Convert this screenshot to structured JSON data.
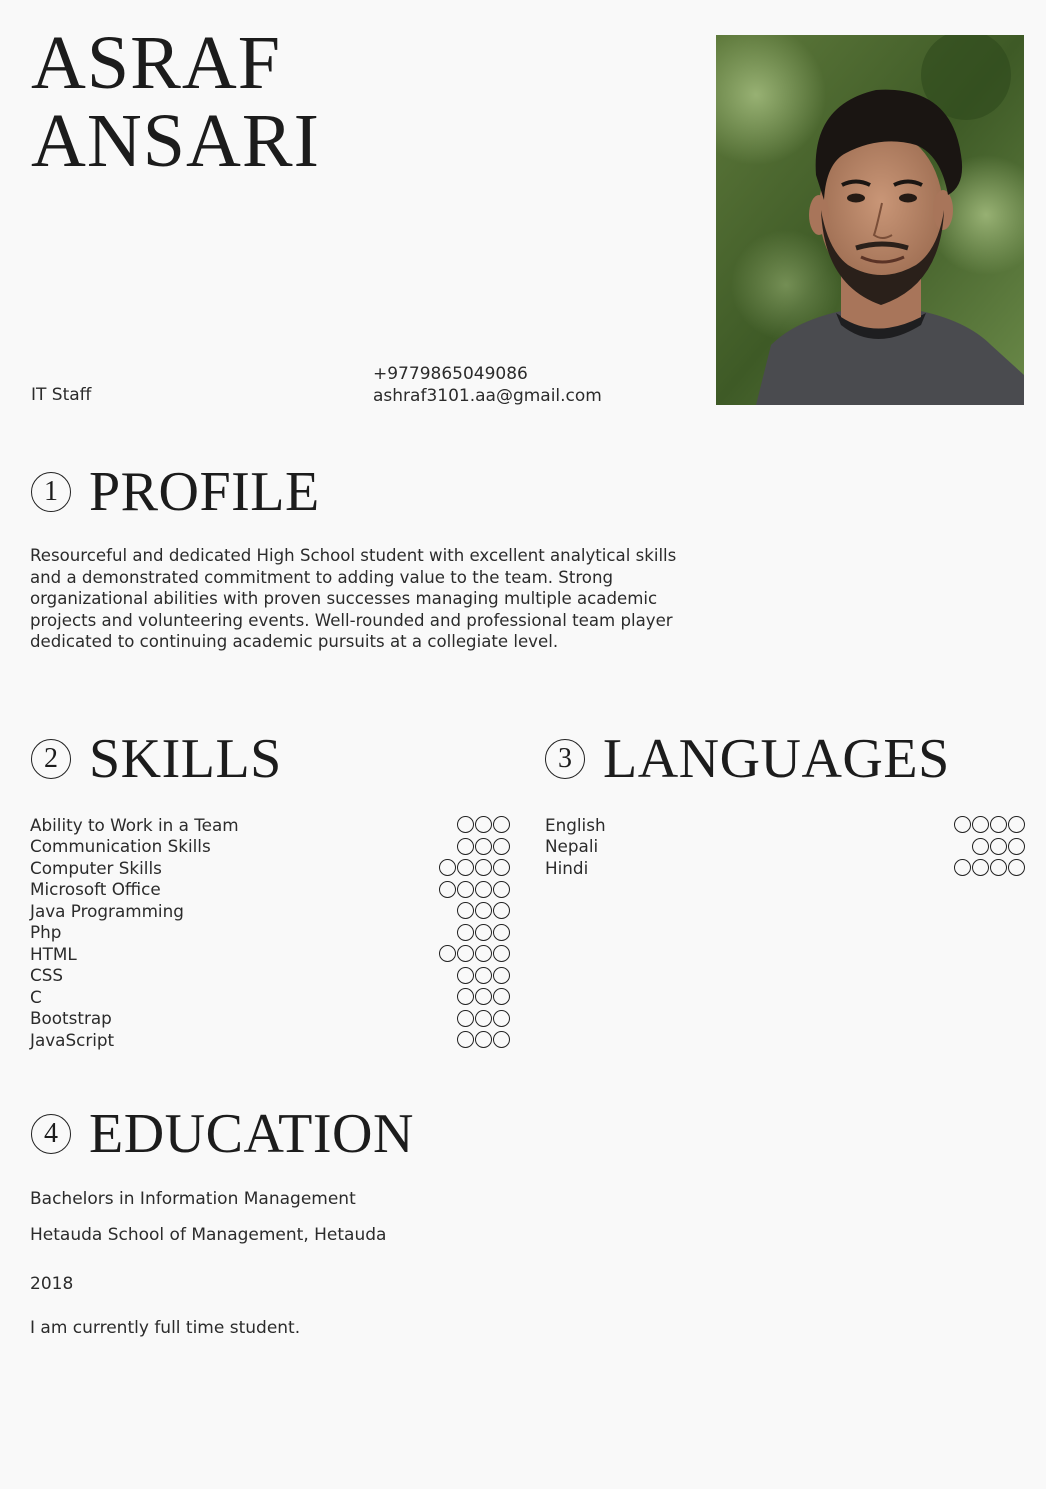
{
  "header": {
    "first_name": "ASRAF",
    "last_name": "ANSARI",
    "job_title": "IT Staff",
    "phone": "+9779865049086",
    "email": "ashraf3101.aa@gmail.com"
  },
  "profile": {
    "number": "1",
    "title": "PROFILE",
    "text": " Resourceful and dedicated High School student with excellent analytical skills and a demonstrated commitment to adding value to the team. Strong organizational abilities with proven successes managing multiple academic projects and volunteering events. Well-rounded and professional team player dedicated to continuing academic pursuits at a collegiate level."
  },
  "skills": {
    "number": "2",
    "title": "SKILLS",
    "items": [
      {
        "label": "Ability to Work in a Team",
        "level": 3
      },
      {
        "label": "Communication Skills",
        "level": 3
      },
      {
        "label": "Computer Skills",
        "level": 4
      },
      {
        "label": "Microsoft Office",
        "level": 4
      },
      {
        "label": "Java Programming",
        "level": 3
      },
      {
        "label": "Php",
        "level": 3
      },
      {
        "label": "HTML",
        "level": 4
      },
      {
        "label": "CSS",
        "level": 3
      },
      {
        "label": "C",
        "level": 3
      },
      {
        "label": "Bootstrap",
        "level": 3
      },
      {
        "label": "JavaScript",
        "level": 3
      }
    ]
  },
  "languages": {
    "number": "3",
    "title": "LANGUAGES",
    "items": [
      {
        "label": "English",
        "level": 4
      },
      {
        "label": "Nepali",
        "level": 3
      },
      {
        "label": "Hindi",
        "level": 4
      }
    ]
  },
  "education": {
    "number": "4",
    "title": "EDUCATION",
    "degree": "Bachelors in Information Management",
    "school": "Hetauda School of Management, Hetauda",
    "year": "2018",
    "note": "I am currently full time student."
  }
}
